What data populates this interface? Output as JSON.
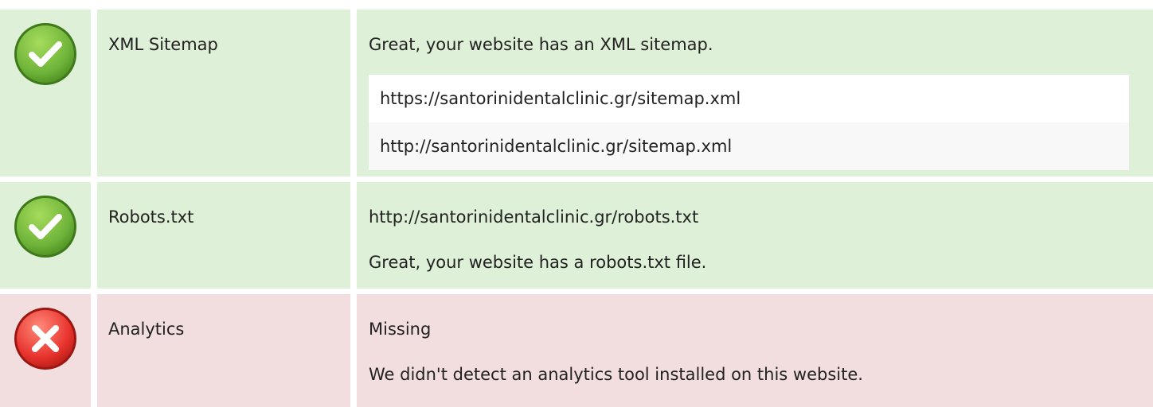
{
  "rows": [
    {
      "status": "pass",
      "icon": "check-circle-icon",
      "label": "XML Sitemap",
      "message": "Great, your website has an XML sitemap.",
      "urls": [
        "https://santorinidentalclinic.gr/sitemap.xml",
        "http://santorinidentalclinic.gr/sitemap.xml"
      ]
    },
    {
      "status": "pass",
      "icon": "check-circle-icon",
      "label": "Robots.txt",
      "url": "http://santorinidentalclinic.gr/robots.txt",
      "message": "Great, your website has a robots.txt file."
    },
    {
      "status": "fail",
      "icon": "cross-circle-icon",
      "label": "Analytics",
      "value": "Missing",
      "message": "We didn't detect an analytics tool installed on this website."
    }
  ],
  "colors": {
    "pass_background": "#dff0d8",
    "fail_background": "#f2dede",
    "pass_icon": "#7cc043",
    "fail_icon": "#e8332d"
  }
}
